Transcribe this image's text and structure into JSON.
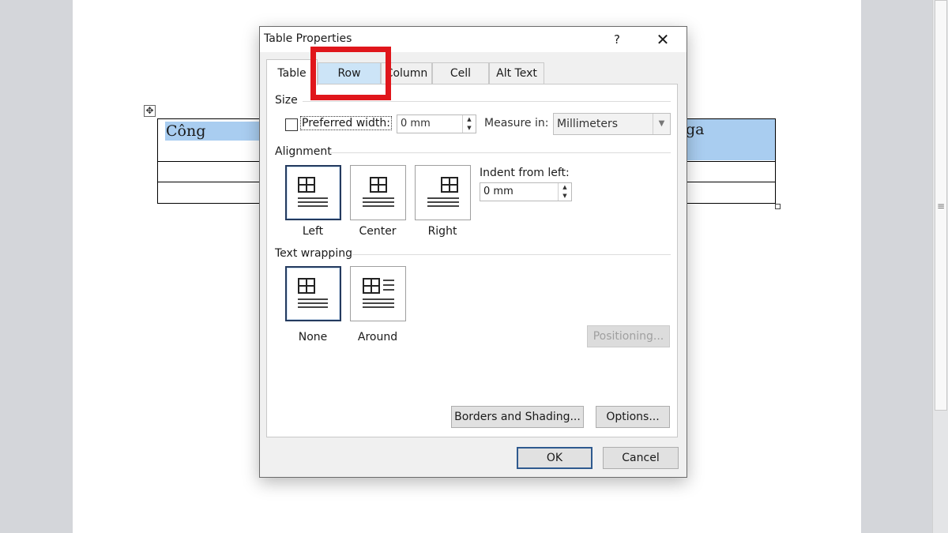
{
  "document": {
    "table_cell_left": "Công",
    "table_cell_right": "ga"
  },
  "dialog": {
    "title": "Table Properties",
    "help": "?",
    "close": "✕",
    "tabs": [
      {
        "label": "Table",
        "active": true
      },
      {
        "label": "Row",
        "highlighted": true
      },
      {
        "label": "Column"
      },
      {
        "label": "Cell"
      },
      {
        "label": "Alt Text"
      }
    ],
    "highlight_color": "#e0161b",
    "size": {
      "heading": "Size",
      "preferred_width_label": "Preferred width:",
      "preferred_width_checked": false,
      "preferred_width_value": "0 mm",
      "measure_label": "Measure in:",
      "measure_value": "Millimeters"
    },
    "alignment": {
      "heading": "Alignment",
      "options": [
        "Left",
        "Center",
        "Right"
      ],
      "selected": "Left",
      "indent_label": "Indent from left:",
      "indent_value": "0 mm"
    },
    "wrapping": {
      "heading": "Text wrapping",
      "options": [
        "None",
        "Around"
      ],
      "selected": "None",
      "positioning_label": "Positioning..."
    },
    "buttons": {
      "borders": "Borders and Shading...",
      "options": "Options...",
      "ok": "OK",
      "cancel": "Cancel"
    }
  },
  "icons": [
    "move-handle-icon",
    "help-icon",
    "close-icon",
    "spin-up-icon",
    "spin-down-icon",
    "dropdown-arrow-icon",
    "align-left-icon",
    "align-center-icon",
    "align-right-icon",
    "wrap-none-icon",
    "wrap-around-icon"
  ]
}
